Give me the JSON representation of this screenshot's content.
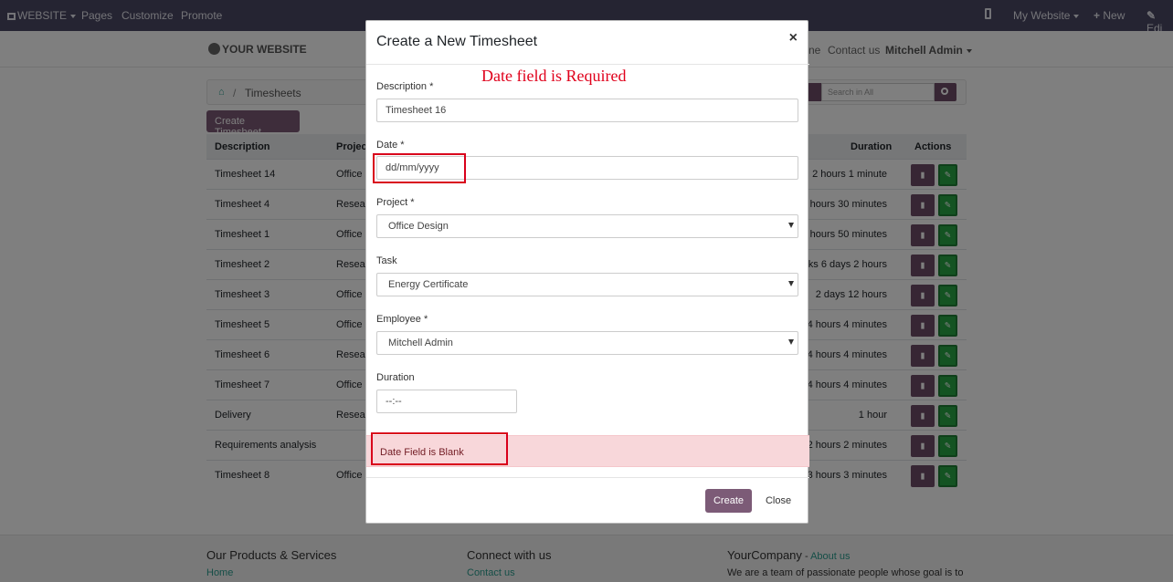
{
  "topbar": {
    "website_label": "WEBSITE",
    "menu": [
      "Pages",
      "Customize",
      "Promote"
    ],
    "my_website": "My Website",
    "new_label": "New",
    "edit_label": "Edi"
  },
  "site": {
    "logo_text": "YOUR WEBSITE",
    "nav_partial": "ne",
    "contact_link": "Contact us",
    "user": "Mitchell Admin"
  },
  "breadcrumb": {
    "current": "Timesheets"
  },
  "search": {
    "placeholder": "Search in All"
  },
  "create_timesheet_button": "Create Timesheet",
  "table": {
    "headers": {
      "description": "Description",
      "project": "Projec",
      "duration": "Duration",
      "actions": "Actions"
    },
    "rows": [
      {
        "description": "Timesheet 14",
        "project": "Office I",
        "duration": "2 hours 1 minute"
      },
      {
        "description": "Timesheet 4",
        "project": "Resear",
        "duration": "7 hours 30 minutes"
      },
      {
        "description": "Timesheet 1",
        "project": "Office I",
        "duration": "0 hours 50 minutes"
      },
      {
        "description": "Timesheet 2",
        "project": "Resear",
        "duration": "eks 6 days 2 hours"
      },
      {
        "description": "Timesheet 3",
        "project": "Office I",
        "duration": "2 days 12 hours"
      },
      {
        "description": "Timesheet 5",
        "project": "Office I",
        "duration": "4 hours 4 minutes"
      },
      {
        "description": "Timesheet 6",
        "project": "Resear",
        "duration": "4 hours 4 minutes"
      },
      {
        "description": "Timesheet 7",
        "project": "Office I",
        "duration": "4 hours 4 minutes"
      },
      {
        "description": "Delivery",
        "project": "Resear",
        "duration": "1 hour"
      },
      {
        "description": "Requirements analysis",
        "project": "",
        "duration": "2 hours 2 minutes"
      },
      {
        "description": "Timesheet 8",
        "project": "Office I",
        "duration": "3 hours 3 minutes"
      }
    ]
  },
  "footer": {
    "col1_title": "Our Products & Services",
    "col1_link": "Home",
    "col2_title": "Connect with us",
    "col2_link": "Contact us",
    "col3_title": "YourCompany",
    "col3_sep": " - ",
    "col3_link": "About us",
    "col3_text": "We are a team of passionate people whose goal is to"
  },
  "modal": {
    "title": "Create a New Timesheet",
    "close_symbol": "×",
    "annotation": "Date field is Required",
    "description_label": "Description *",
    "description_value": "Timesheet 16",
    "date_label": "Date *",
    "date_placeholder": "dd/mm/yyyy",
    "project_label": "Project *",
    "project_value": "Office Design",
    "task_label": "Task",
    "task_value": "Energy Certificate",
    "employee_label": "Employee *",
    "employee_value": "Mitchell Admin",
    "duration_label": "Duration",
    "duration_placeholder": "--:--",
    "alert_text": "Date Field is Blank",
    "create_button": "Create",
    "close_button": "Close"
  },
  "colors": {
    "topbar": "#4b4965",
    "primary": "#7c5b77",
    "success": "#28a745",
    "alert_bg": "#f8d7da",
    "annotation_red": "#e0001b"
  }
}
